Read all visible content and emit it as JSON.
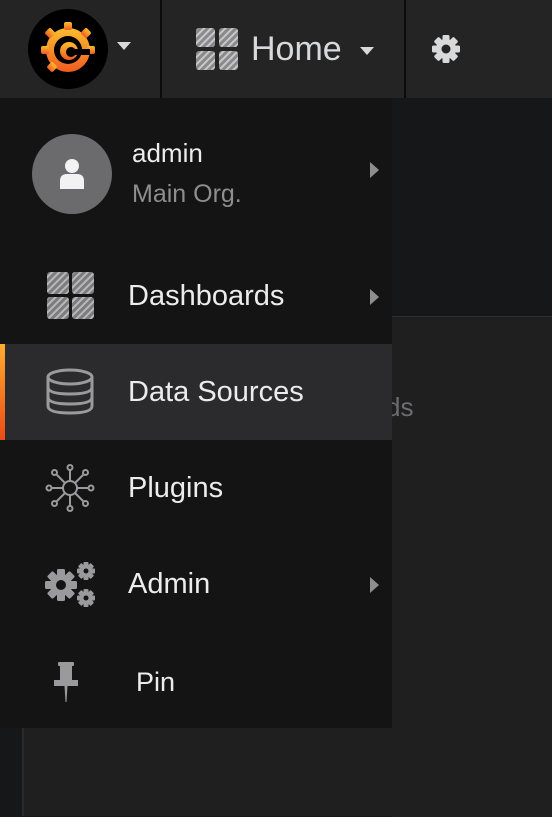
{
  "navbar": {
    "home_label": "Home",
    "icons": {
      "logo": "grafana-logo-icon",
      "dashboard": "dashboard-grid-icon",
      "settings": "gear-icon"
    }
  },
  "user": {
    "name": "admin",
    "org": "Main Org."
  },
  "menu": {
    "items": [
      {
        "label": "Dashboards",
        "icon": "dashboard-grid-icon",
        "has_submenu": true
      },
      {
        "label": "Data Sources",
        "icon": "database-icon",
        "has_submenu": false,
        "active": true
      },
      {
        "label": "Plugins",
        "icon": "plugins-icon",
        "has_submenu": false
      },
      {
        "label": "Admin",
        "icon": "cogs-icon",
        "has_submenu": true
      },
      {
        "label": "Pin",
        "icon": "pin-icon",
        "has_submenu": false
      }
    ]
  },
  "background": {
    "partial_text": "ds"
  },
  "colors": {
    "accent_top": "#ffac2f",
    "accent_bottom": "#eb4b16",
    "menu_bg": "#141414",
    "navbar_bg": "#242425"
  }
}
